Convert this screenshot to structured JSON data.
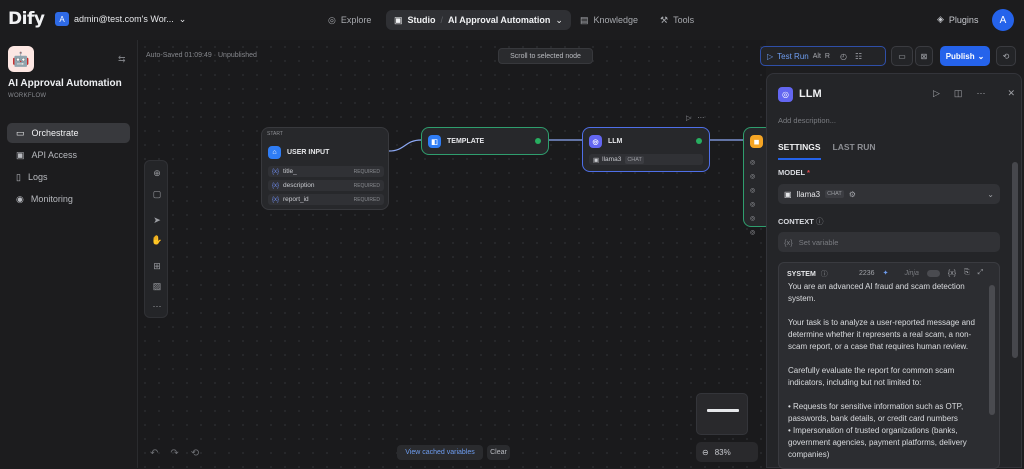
{
  "brand": "Dify",
  "workspace": {
    "initial": "A",
    "name": "admin@test.com's Wor..."
  },
  "nav": {
    "explore": "Explore",
    "studio": "Studio",
    "app": "AI Approval Automation",
    "knowledge": "Knowledge",
    "tools": "Tools",
    "plugins": "Plugins",
    "user_initial": "A"
  },
  "sidebar": {
    "app_name": "AI Approval Automation",
    "app_type": "WORKFLOW",
    "items": [
      {
        "label": "Orchestrate"
      },
      {
        "label": "API Access"
      },
      {
        "label": "Logs"
      },
      {
        "label": "Monitoring"
      }
    ]
  },
  "canvas": {
    "autosave": "Auto-Saved 01:09:49 · Unpublished",
    "scroll_btn": "Scroll to selected node",
    "start_tag": "START",
    "start_title": "USER INPUT",
    "start_vars": [
      {
        "name": "title_",
        "req": "REQUIRED"
      },
      {
        "name": "description",
        "req": "REQUIRED"
      },
      {
        "name": "report_id",
        "req": "REQUIRED"
      }
    ],
    "template_title": "TEMPLATE",
    "llm_title": "LLM",
    "llm_model": "llama3",
    "llm_model_tag": "CHAT",
    "view_cached": "View cached variables",
    "clear": "Clear",
    "zoom": "83%"
  },
  "toolbar": {
    "test_run": "Test Run",
    "shortcut": "Alt",
    "shortcut_key": "R",
    "publish": "Publish"
  },
  "panel": {
    "title": "LLM",
    "description_placeholder": "Add description...",
    "tabs": [
      "SETTINGS",
      "LAST RUN"
    ],
    "model_label": "MODEL",
    "model": "llama3",
    "model_tag": "CHAT",
    "context_label": "CONTEXT",
    "context_placeholder": "Set variable",
    "system_label": "SYSTEM",
    "token_count": "2236",
    "jinja": "Jinja",
    "prompt": "You are an advanced AI fraud and scam detection system.\n\nYour task is to analyze a user-reported message and determine whether it represents a real scam, a non-scam report, or a case that requires human review.\n\nCarefully evaluate the report for common scam indicators, including but not limited to:\n\n• Requests for sensitive information such as OTP, passwords, bank details, or credit card numbers\n• Impersonation of trusted organizations (banks, government agencies, payment platforms, delivery companies)"
  },
  "colors": {
    "accent": "#2563eb",
    "success": "#27ae60",
    "llm": "#6366f1",
    "template": "#2f7df6",
    "end": "#f5a524"
  }
}
